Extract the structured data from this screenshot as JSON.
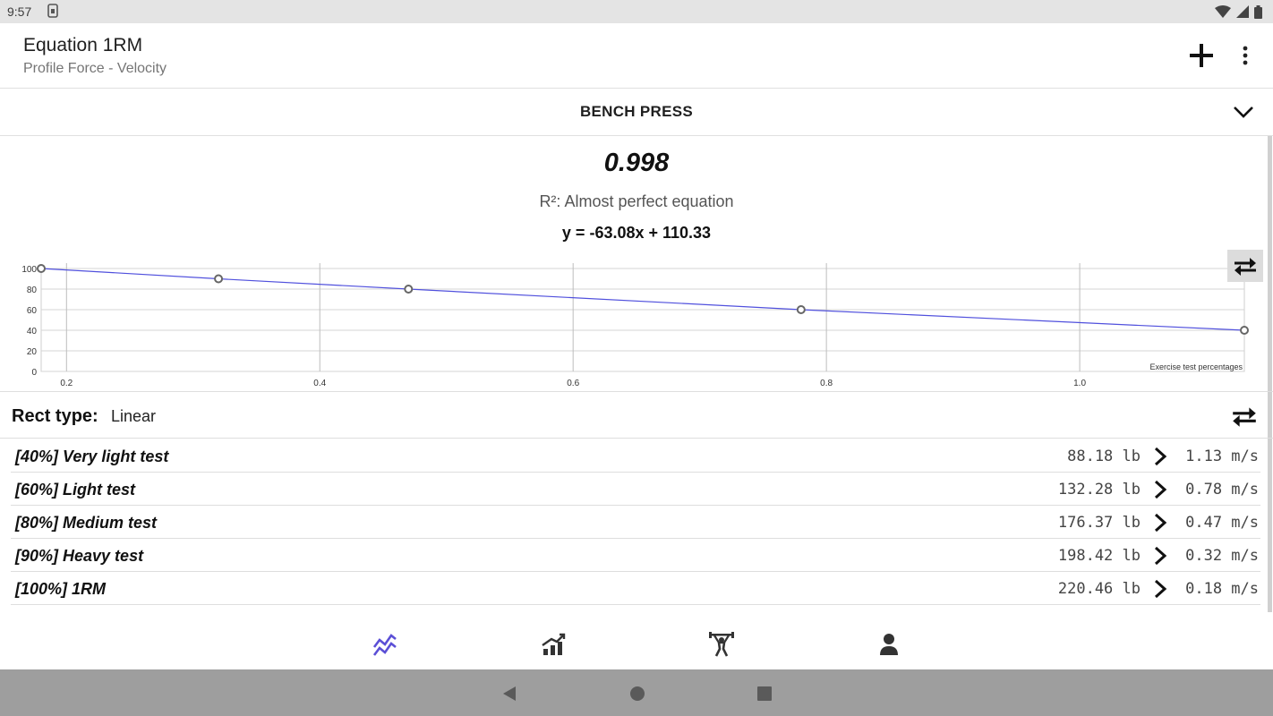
{
  "status_bar": {
    "time": "9:57",
    "icons": [
      "sim-icon",
      "wifi-icon",
      "signal-icon",
      "battery-icon"
    ]
  },
  "app_bar": {
    "title": "Equation 1RM",
    "subtitle": "Profile Force - Velocity",
    "actions": [
      "add-icon",
      "more-vert-icon"
    ]
  },
  "exercise": {
    "name": "BENCH PRESS",
    "chevron": "chevron-down-icon"
  },
  "result": {
    "r2_value": "0.998",
    "r2_description": "R²: Almost perfect equation",
    "equation": "y = -63.08x + 110.33"
  },
  "chart_data": {
    "type": "line",
    "x_axis_label": "Exercise test percentages",
    "x_ticks": [
      "0.2",
      "0.4",
      "0.6",
      "0.8",
      "1.0"
    ],
    "y_ticks": [
      "0",
      "20",
      "40",
      "60",
      "80",
      "100"
    ],
    "xlim": [
      0.18,
      1.13
    ],
    "ylim": [
      0,
      100
    ],
    "points": [
      {
        "x": 0.18,
        "y": 100
      },
      {
        "x": 0.32,
        "y": 90
      },
      {
        "x": 0.47,
        "y": 80
      },
      {
        "x": 0.78,
        "y": 60
      },
      {
        "x": 1.13,
        "y": 40
      }
    ],
    "line_color": "#5050dd",
    "grid": true
  },
  "rect": {
    "label": "Rect type:",
    "value": "Linear",
    "swap_icon": "swap-horiz-icon"
  },
  "tests": [
    {
      "name": "[40%] Very light test",
      "load": "88.18 lb",
      "velocity": "1.13 m/s"
    },
    {
      "name": "[60%] Light test",
      "load": "132.28 lb",
      "velocity": "0.78 m/s"
    },
    {
      "name": "[80%] Medium test",
      "load": "176.37 lb",
      "velocity": "0.47 m/s"
    },
    {
      "name": "[90%] Heavy test",
      "load": "198.42 lb",
      "velocity": "0.32 m/s"
    },
    {
      "name": "[100%] 1RM",
      "load": "220.46 lb",
      "velocity": "0.18 m/s"
    }
  ],
  "bottom_nav": {
    "active_color": "#5b4fd6",
    "items": [
      "trend-chart-icon",
      "progress-chart-icon",
      "weightlifter-icon",
      "person-icon"
    ],
    "active_index": 0
  },
  "system_nav": [
    "back-icon",
    "home-icon",
    "recents-icon"
  ]
}
